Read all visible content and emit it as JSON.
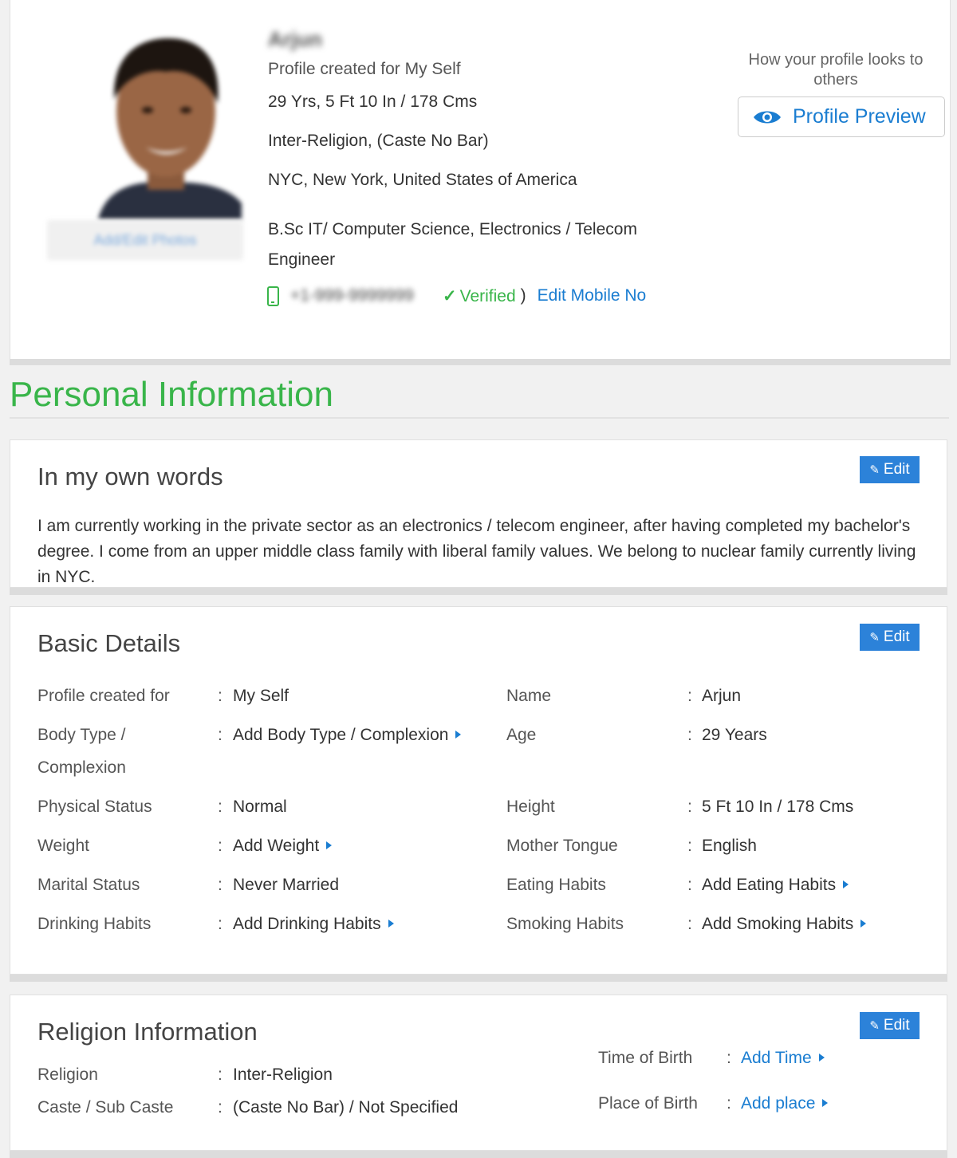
{
  "profile": {
    "name": "Arjun",
    "photo_button": "Add/Edit Photos",
    "created_for": "Profile created for My Self",
    "age_height": "29 Yrs, 5 Ft 10  In / 178 Cms",
    "religion": "Inter-Religion, (Caste No Bar)",
    "location": "NYC, New York, United States of America",
    "education": "B.Sc IT/ Computer Science, Electronics / Telecom Engineer",
    "mobile_number": "+1-999-9999999",
    "verified_label": "Verified",
    "edit_mobile_label": "Edit Mobile No",
    "preview_caption": "How your profile looks to others",
    "preview_button": "Profile Preview",
    "accent_color": "#1a7dd1",
    "verified_color": "#39b54a"
  },
  "personal_heading": "Personal Information",
  "about": {
    "title": "In my own words",
    "edit_label": "Edit",
    "text": "I am currently working in the private sector as an electronics / telecom engineer, after having completed my bachelor's degree. I come from an upper middle class family with liberal family values. We belong to nuclear family currently living in NYC."
  },
  "basic": {
    "title": "Basic Details",
    "edit_label": "Edit",
    "left": [
      {
        "label": "Profile created for",
        "value": "My Self",
        "link": false
      },
      {
        "label": "Body Type / Complexion",
        "value": "Add Body Type / Complexion",
        "link": true
      },
      {
        "label": "Physical Status",
        "value": "Normal",
        "link": false
      },
      {
        "label": "Weight",
        "value": "Add Weight",
        "link": true
      },
      {
        "label": "Marital Status",
        "value": "Never Married",
        "link": false
      },
      {
        "label": "Drinking Habits",
        "value": "Add Drinking Habits",
        "link": true
      }
    ],
    "right": [
      {
        "label": "Name",
        "value": "Arjun",
        "link": false
      },
      {
        "label": "Age",
        "value": "29 Years",
        "link": false
      },
      {
        "label": "Height",
        "value": "5 Ft 10  In / 178 Cms",
        "link": false
      },
      {
        "label": "Mother Tongue",
        "value": "English",
        "link": false
      },
      {
        "label": "Eating Habits",
        "value": "Add Eating Habits",
        "link": true
      },
      {
        "label": "Smoking Habits",
        "value": "Add Smoking Habits",
        "link": true
      }
    ]
  },
  "religion_info": {
    "title": "Religion Information",
    "edit_label": "Edit",
    "religion_label": "Religion",
    "religion_value": "Inter-Religion",
    "caste_label": "Caste / Sub Caste",
    "caste_value": "(Caste No Bar) / Not Specified",
    "time_label": "Time of Birth",
    "time_value": "Add Time",
    "place_label": "Place of Birth",
    "place_value": "Add place"
  },
  "icons": {
    "eye": "eye-icon",
    "phone": "mobile-phone-icon",
    "check": "check-icon",
    "pencil": "pencil-icon",
    "arrow": "caret-right-icon"
  }
}
